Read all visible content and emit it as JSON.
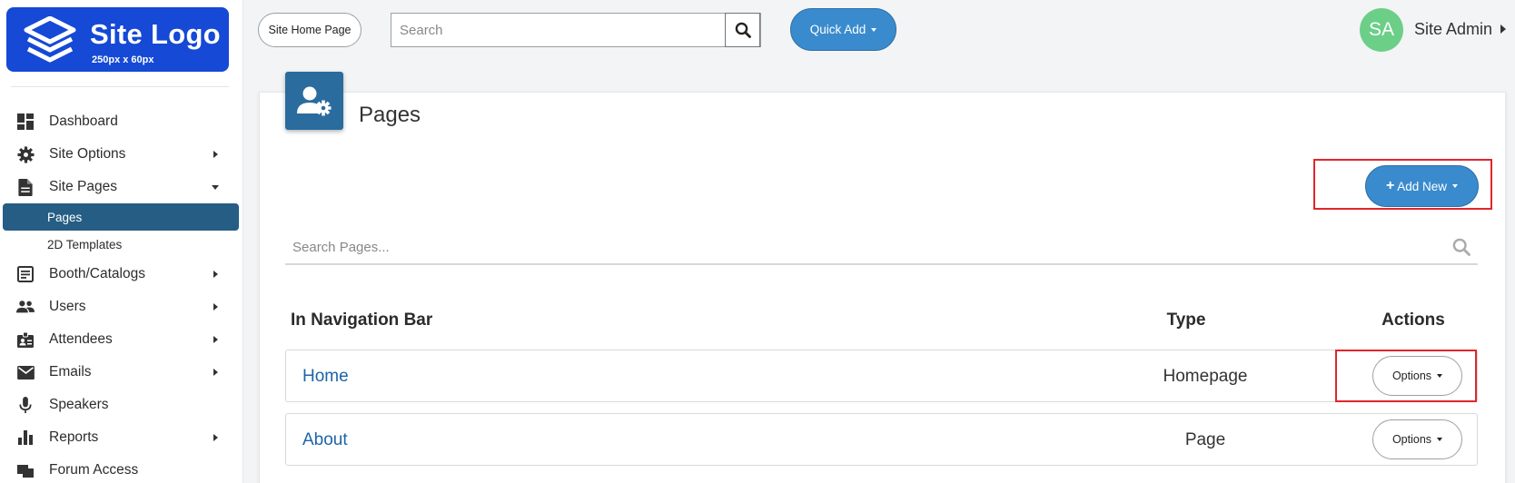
{
  "logo": {
    "title": "Site Logo",
    "subtitle": "250px x 60px"
  },
  "sidebar": {
    "items": [
      {
        "label": "Dashboard",
        "icon": "dashboard-icon"
      },
      {
        "label": "Site Options",
        "icon": "gear-icon"
      },
      {
        "label": "Site Pages",
        "icon": "document-icon"
      },
      {
        "label": "Pages"
      },
      {
        "label": "2D Templates"
      },
      {
        "label": "Booth/Catalogs",
        "icon": "catalog-icon"
      },
      {
        "label": "Users",
        "icon": "users-icon"
      },
      {
        "label": "Attendees",
        "icon": "badge-icon"
      },
      {
        "label": "Emails",
        "icon": "envelope-icon"
      },
      {
        "label": "Speakers",
        "icon": "microphone-icon"
      },
      {
        "label": "Reports",
        "icon": "bar-chart-icon"
      },
      {
        "label": "Forum Access",
        "icon": "forum-icon"
      }
    ]
  },
  "topbar": {
    "home_label": "Site Home Page",
    "search_placeholder": "Search",
    "quick_add_label": "Quick Add",
    "avatar_initials": "SA",
    "admin_name": "Site Admin"
  },
  "main": {
    "title": "Pages",
    "add_new_label": "Add New",
    "search_placeholder": "Search Pages...",
    "columns": [
      "In Navigation Bar",
      "Type",
      "Actions"
    ],
    "rows": [
      {
        "name": "Home",
        "type": "Homepage",
        "action": "Options"
      },
      {
        "name": "About",
        "type": "Page",
        "action": "Options"
      }
    ]
  },
  "colors": {
    "brand": "#1549d6",
    "accent": "#3a8bcd",
    "active_nav": "#255d84",
    "avatar": "#6ccf88",
    "highlight": "#e0262c",
    "link": "#1e64a8"
  }
}
